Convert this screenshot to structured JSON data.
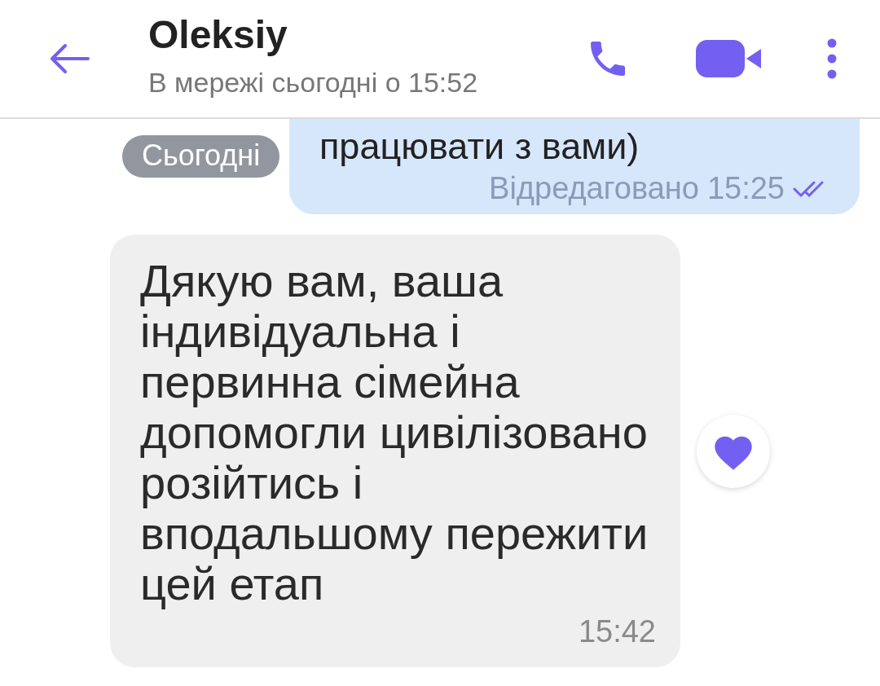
{
  "header": {
    "title": "Oleksiy",
    "status": "В мережі сьогодні о 15:52"
  },
  "date_divider": "Сьогодні",
  "messages": [
    {
      "kind": "outgoing",
      "text": "працювати з вами)",
      "edited_label": "Відредаговано",
      "time": "15:25",
      "read": true
    },
    {
      "kind": "incoming",
      "text": "Дякую вам, ваша індивідуальна і первинна сімейна допомогли цивілізовано розійтись і вподальшому пережити цей етап",
      "time": "15:42",
      "liked": true
    }
  ]
}
